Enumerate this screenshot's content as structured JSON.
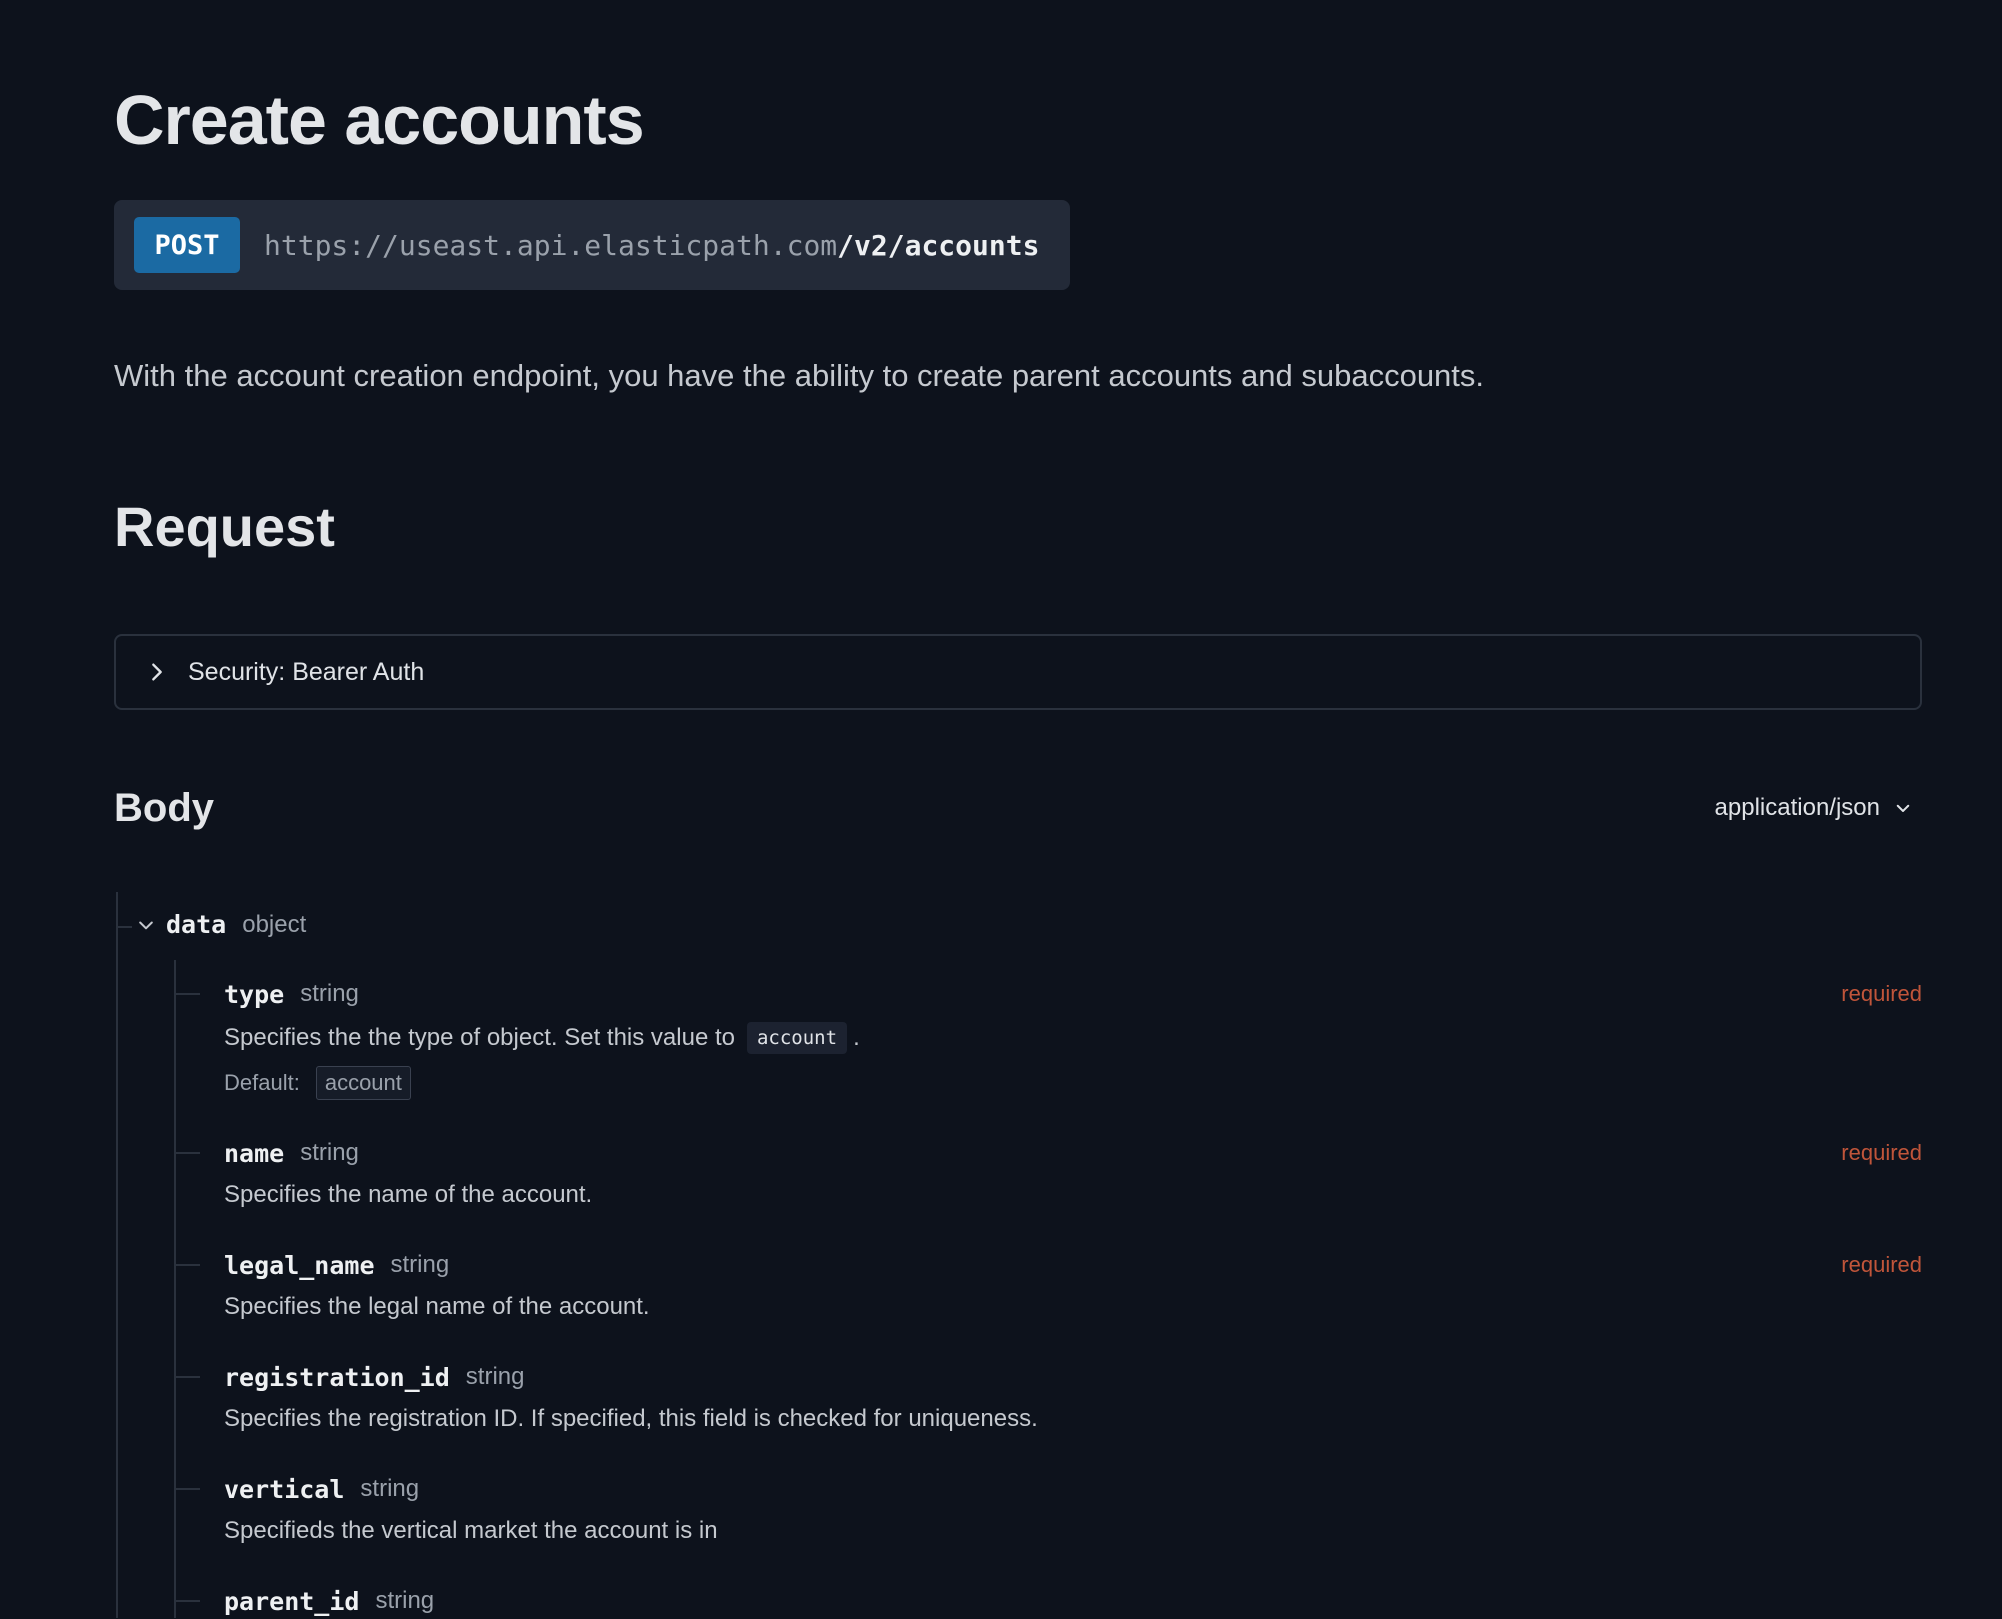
{
  "page": {
    "title": "Create accounts",
    "description": "With the account creation endpoint, you have the ability to create parent accounts and subaccounts."
  },
  "endpoint": {
    "method": "POST",
    "base_url": "https://useast.api.elasticpath.com",
    "path": "/v2/accounts"
  },
  "request": {
    "heading": "Request",
    "security_label": "Security: Bearer Auth"
  },
  "body": {
    "heading": "Body",
    "content_type": "application/json",
    "root": {
      "name": "data",
      "type": "object"
    },
    "properties": [
      {
        "name": "type",
        "type": "string",
        "required": "required",
        "description_before": "Specifies the the type of object. Set this value to",
        "description_code": "account",
        "description_after": ".",
        "default_label": "Default:",
        "default_value": "account"
      },
      {
        "name": "name",
        "type": "string",
        "required": "required",
        "description": "Specifies the name of the account."
      },
      {
        "name": "legal_name",
        "type": "string",
        "required": "required",
        "description": "Specifies the legal name of the account."
      },
      {
        "name": "registration_id",
        "type": "string",
        "description": "Specifies the registration ID. If specified, this field is checked for uniqueness."
      },
      {
        "name": "vertical",
        "type": "string",
        "description": "Specifieds the vertical market the account is in"
      },
      {
        "name": "parent_id",
        "type": "string"
      }
    ]
  },
  "colors": {
    "background": "#0d121c",
    "method_badge": "#1b6aa3",
    "required": "#c0553a"
  },
  "icons": {
    "security_toggle": "chevron-right-icon",
    "content_type_dropdown": "chevron-down-icon",
    "data_toggle": "chevron-down-icon"
  }
}
